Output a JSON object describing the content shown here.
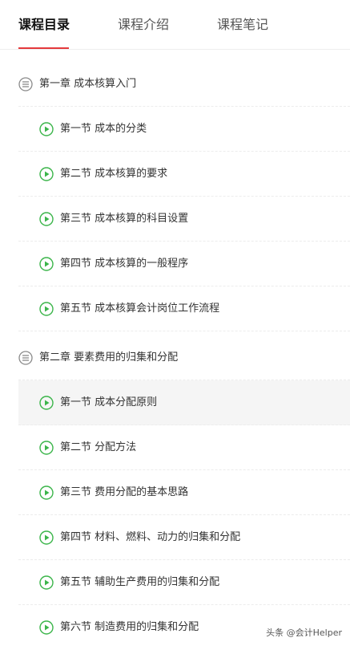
{
  "colors": {
    "accent": "#e4393c",
    "play": "#3bb54a",
    "text": "#333333",
    "chapter_icon": "#8a8a8a"
  },
  "tabs": [
    {
      "label": "课程目录",
      "active": true
    },
    {
      "label": "课程介绍",
      "active": false
    },
    {
      "label": "课程笔记",
      "active": false
    }
  ],
  "chapters": [
    {
      "title": "第一章 成本核算入门",
      "icon": "list-icon",
      "sections": [
        {
          "title": "第一节 成本的分类",
          "icon": "play-icon"
        },
        {
          "title": "第二节 成本核算的要求",
          "icon": "play-icon"
        },
        {
          "title": "第三节 成本核算的科目设置",
          "icon": "play-icon"
        },
        {
          "title": "第四节 成本核算的一般程序",
          "icon": "play-icon"
        },
        {
          "title": "第五节 成本核算会计岗位工作流程",
          "icon": "play-icon"
        }
      ]
    },
    {
      "title": "第二章 要素费用的归集和分配",
      "icon": "list-icon",
      "sections": [
        {
          "title": "第一节 成本分配原则",
          "icon": "play-icon",
          "active": true
        },
        {
          "title": "第二节 分配方法",
          "icon": "play-icon"
        },
        {
          "title": "第三节 费用分配的基本思路",
          "icon": "play-icon"
        },
        {
          "title": "第四节 材料、燃料、动力的归集和分配",
          "icon": "play-icon"
        },
        {
          "title": "第五节 辅助生产费用的归集和分配",
          "icon": "play-icon"
        },
        {
          "title": "第六节 制造费用的归集和分配",
          "icon": "play-icon"
        }
      ]
    }
  ],
  "watermark": "头条 @会计Helper"
}
